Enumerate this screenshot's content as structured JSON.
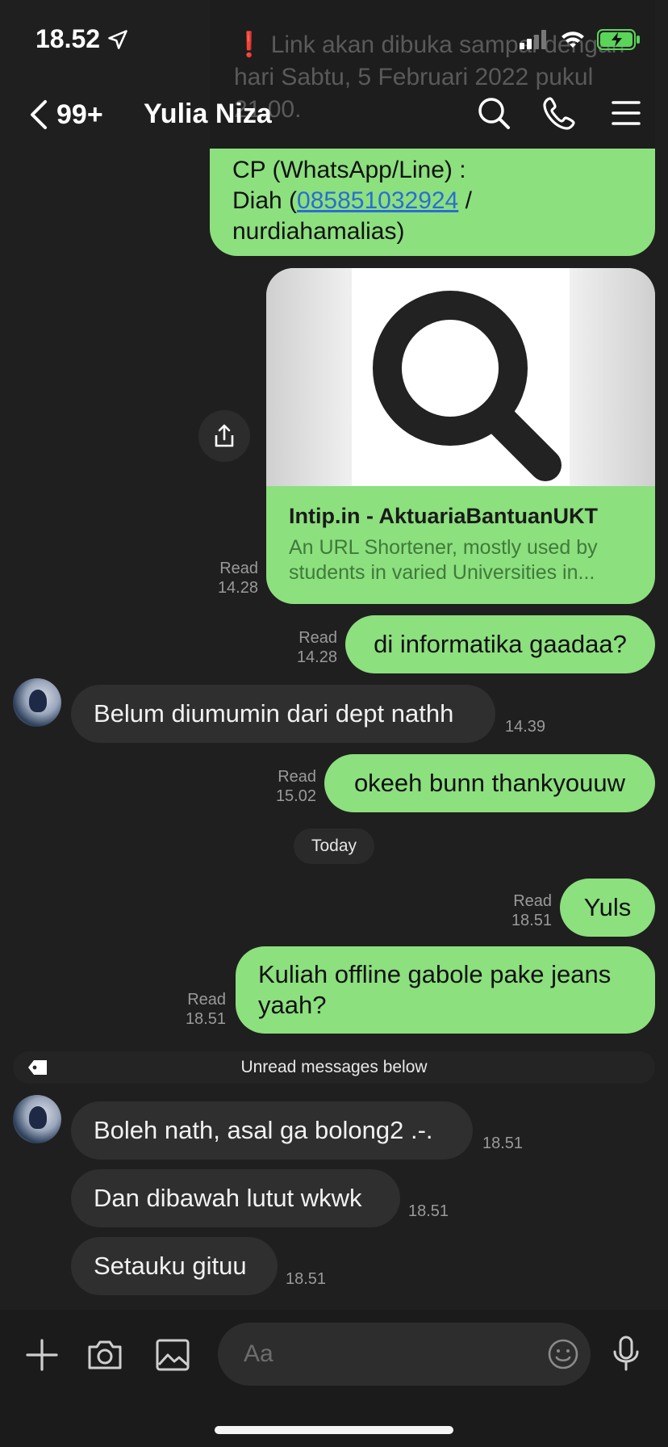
{
  "status_bar": {
    "time": "18.52"
  },
  "header": {
    "back_count": "99+",
    "contact_name": "Yulia Niza"
  },
  "preview_overlay": {
    "text": "❗ Link akan dibuka sampai dengan hari Sabtu, 5 Februari 2022 pukul 21.00."
  },
  "top_message": {
    "line1": "CP (WhatsApp/Line) :",
    "line2_prefix": "Diah (",
    "phone": "085851032924",
    "line2_suffix": " /",
    "line3": "nurdiahamalias)"
  },
  "link_card": {
    "title": "Intip.in - AktuariaBantuanUKT",
    "description": "An URL Shortener, mostly used by students in varied Universities in...",
    "read_label": "Read",
    "time": "14.28"
  },
  "messages": [
    {
      "id": "m1",
      "direction": "out",
      "text": "di informatika gaadaa?",
      "read": "Read",
      "time": "14.28"
    },
    {
      "id": "m2",
      "direction": "in",
      "text": "Belum diumumin dari dept nathh",
      "time": "14.39"
    },
    {
      "id": "m3",
      "direction": "out",
      "text": "okeeh bunn thankyouuw",
      "read": "Read",
      "time": "15.02"
    },
    {
      "id": "m4",
      "direction": "out",
      "text": "Yuls",
      "read": "Read",
      "time": "18.51"
    },
    {
      "id": "m5",
      "direction": "out",
      "text": "Kuliah offline gabole pake jeans yaah?",
      "read": "Read",
      "time": "18.51"
    },
    {
      "id": "m6",
      "direction": "in",
      "text": "Boleh nath, asal ga bolong2 .-.",
      "time": "18.51"
    },
    {
      "id": "m7",
      "direction": "in",
      "text": "Dan dibawah lutut wkwk",
      "time": "18.51"
    },
    {
      "id": "m8",
      "direction": "in",
      "text": "Setauku gituu",
      "time": "18.51"
    }
  ],
  "date_divider": "Today",
  "unread_divider": "Unread messages below",
  "input": {
    "placeholder": "Aa"
  },
  "colors": {
    "background": "#1f1f1f",
    "bubble_out": "#8ce07e",
    "bubble_in": "#2f2f2f",
    "link": "#2a6dd6"
  }
}
